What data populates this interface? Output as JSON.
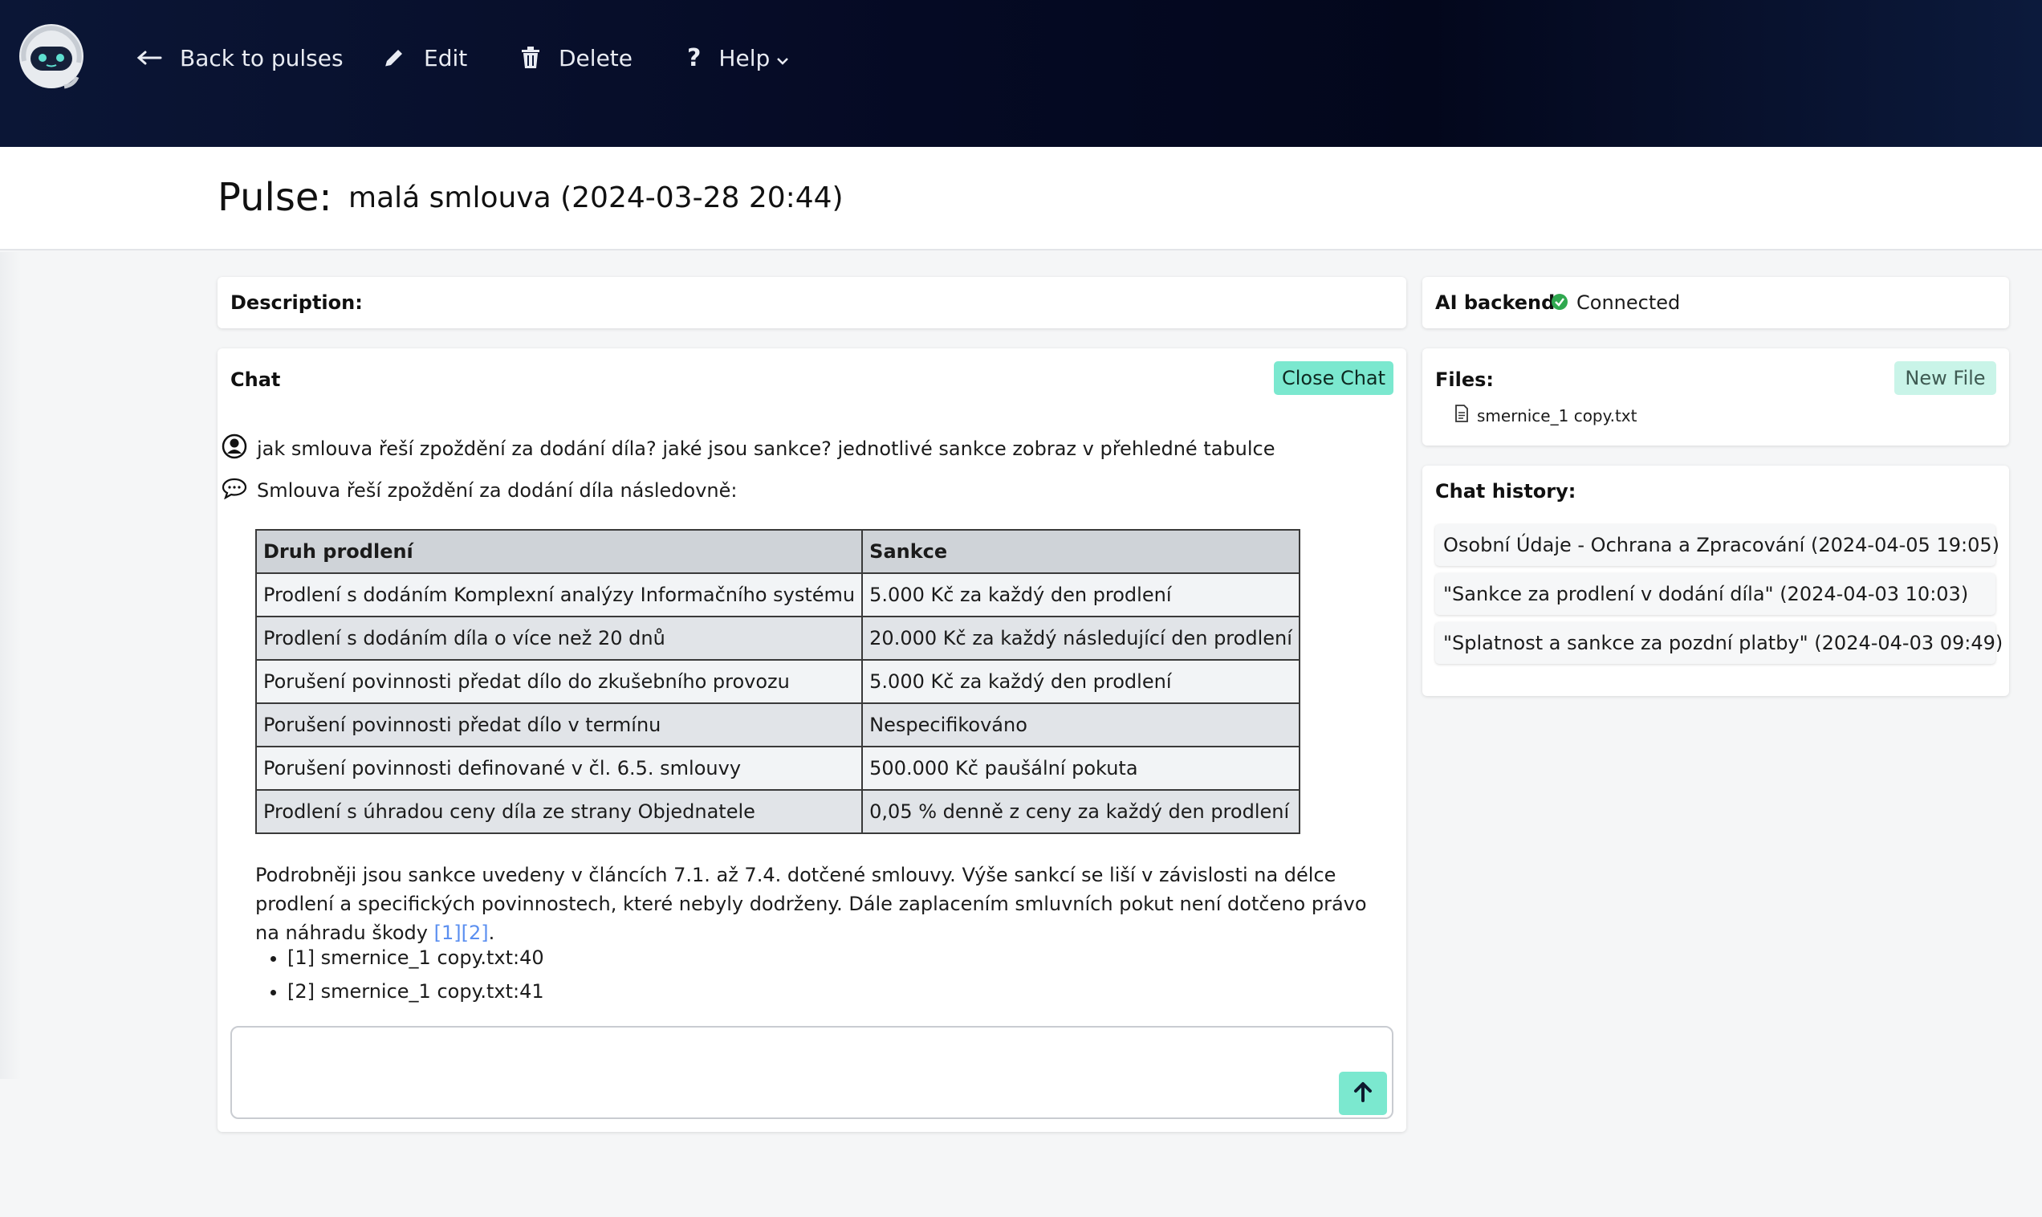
{
  "navbar": {
    "back_label": "Back to pulses",
    "edit_label": "Edit",
    "delete_label": "Delete",
    "help_label": "Help"
  },
  "page": {
    "title_prefix": "Pulse:",
    "title_value": "malá smlouva (2024-03-28 20:44)"
  },
  "description": {
    "label": "Description:"
  },
  "ai_backend": {
    "label": "AI backend:",
    "status": "Connected",
    "status_color": "#2fa84f"
  },
  "chat": {
    "label": "Chat",
    "close_label": "Close Chat",
    "user_message": "jak smlouva řeší zpoždění za dodání díla? jaké jsou sankce? jednotlivé sankce zobraz v přehledné tabulce",
    "bot_intro": "Smlouva řeší zpoždění za dodání díla následovně:",
    "table": {
      "headers": [
        "Druh prodlení",
        "Sankce"
      ],
      "rows": [
        [
          "Prodlení s dodáním Komplexní analýzy Informačního systému",
          "5.000 Kč za každý den prodlení"
        ],
        [
          "Prodlení s dodáním díla o více než 20 dnů",
          "20.000 Kč za každý následující den prodlení"
        ],
        [
          "Porušení povinnosti předat dílo do zkušebního provozu",
          "5.000 Kč za každý den prodlení"
        ],
        [
          "Porušení povinnosti předat dílo v termínu",
          "Nespecifikováno"
        ],
        [
          "Porušení povinnosti definované v čl. 6.5. smlouvy",
          "500.000 Kč paušální pokuta"
        ],
        [
          "Prodlení s úhradou ceny díla ze strany Objednatele",
          "0,05 % denně z ceny za každý den prodlení"
        ]
      ]
    },
    "paragraph": "Podrobněji jsou sankce uvedeny v článcích 7.1. až 7.4. dotčené smlouvy. Výše sankcí se liší v závislosti na délce prodlení a specifických povinnostech, které nebyly dodrženy. Dále zaplacením smluvních pokut není dotčeno právo na náhradu škody ",
    "citation": "[1][2]",
    "paragraph_end": ".",
    "references": [
      "[1] smernice_1 copy.txt:40",
      "[2] smernice_1 copy.txt:41"
    ],
    "input_value": "",
    "accent_color": "#7be8cf"
  },
  "files": {
    "label": "Files:",
    "new_file_label": "New File",
    "items": [
      "smernice_1 copy.txt"
    ]
  },
  "history": {
    "label": "Chat history:",
    "items": [
      "Osobní Údaje - Ochrana a Zpracování (2024-04-05 19:05)",
      "\"Sankce za prodlení v dodání díla\" (2024-04-03 10:03)",
      "\"Splatnost a sankce za pozdní platby\" (2024-04-03 09:49)"
    ]
  },
  "icons": {
    "logo": "robot-logo-icon",
    "back": "arrow-left-icon",
    "edit": "pencil-icon",
    "delete": "trash-icon",
    "help": "question-icon",
    "help_caret": "chevron-down-icon",
    "user": "user-circle-icon",
    "bot": "speech-bubble-icon",
    "status": "check-circle-icon",
    "file": "file-icon",
    "send": "arrow-up-icon"
  }
}
